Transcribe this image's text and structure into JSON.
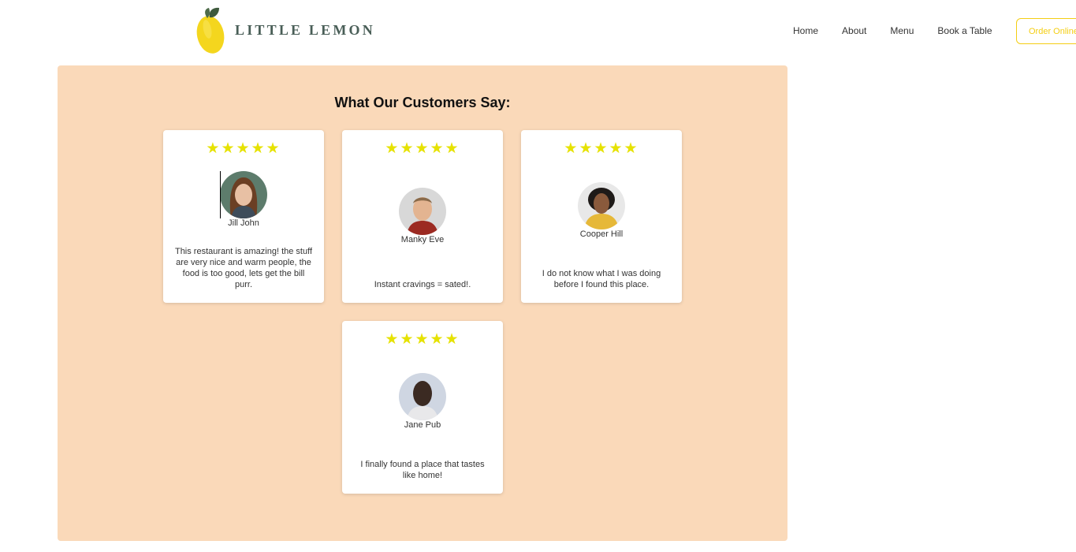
{
  "brand": {
    "name": "LITTLE LEMON",
    "colors": {
      "primary": "#495e57",
      "accent": "#f4ce14",
      "section_bg": "#fad9b9",
      "star": "#e6e200"
    }
  },
  "nav": {
    "items": [
      {
        "label": "Home"
      },
      {
        "label": "About"
      },
      {
        "label": "Menu"
      },
      {
        "label": "Book a Table"
      }
    ],
    "order_button": "Order Online"
  },
  "testimonials": {
    "title": "What Our Customers Say:",
    "reviews": [
      {
        "name": "Jill John",
        "rating": 5,
        "stars": "★★★★★",
        "quote": "This restaurant is amazing! the stuff are very nice and warm people, the food is too good, lets get the bill purr."
      },
      {
        "name": "Manky Eve",
        "rating": 5,
        "stars": "★★★★★",
        "quote": "Instant cravings = sated!."
      },
      {
        "name": "Cooper Hill",
        "rating": 5,
        "stars": "★★★★★",
        "quote": "I do not know what I was doing before I found this place."
      },
      {
        "name": "Jane Pub",
        "rating": 5,
        "stars": "★★★★★",
        "quote": "I finally found a place that tastes like home!"
      }
    ]
  }
}
